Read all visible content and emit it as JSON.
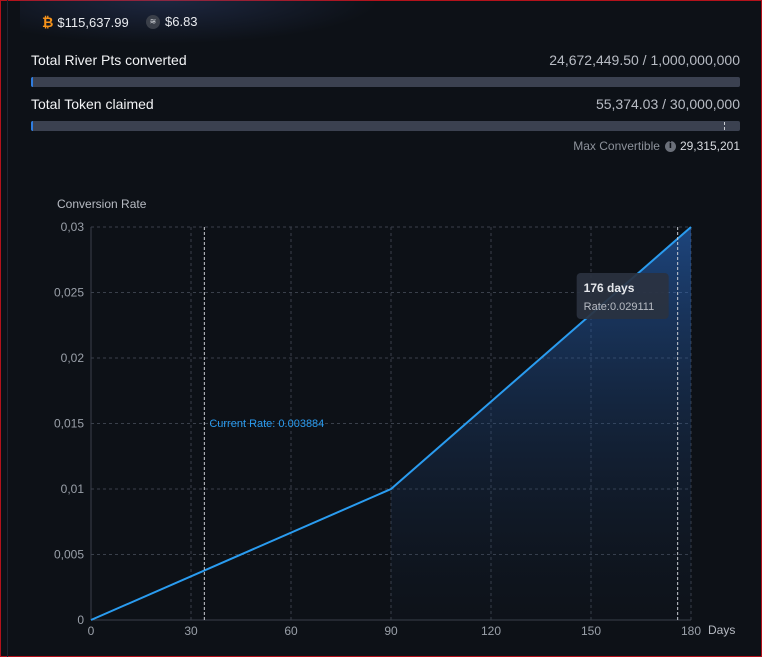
{
  "ticker": {
    "btc": {
      "icon": "bitcoin-icon",
      "price": "$115,637.99"
    },
    "river": {
      "icon": "river-token-icon",
      "price": "$6.83"
    }
  },
  "stats": {
    "river_pts": {
      "label": "Total River Pts converted",
      "value": "24,672,449.50 / 1,000,000,000",
      "fraction": 0.0247
    },
    "token_claimed": {
      "label": "Total Token claimed",
      "value": "55,374.03 / 30,000,000",
      "fraction": 0.0018,
      "marker_fraction": 0.977
    },
    "max_convertible": {
      "label": "Max Convertible",
      "value": "29,315,201",
      "icon": "info-icon"
    }
  },
  "colors": {
    "line": "#2a9cf0",
    "bar_fill": "#2f7de0",
    "bar_track": "#3b4150"
  },
  "chart_data": {
    "type": "line",
    "ylabel": "Conversion Rate",
    "xlabel": "Days",
    "xlim": [
      0,
      180
    ],
    "ylim": [
      0,
      0.03
    ],
    "x_ticks": [
      "0",
      "30",
      "60",
      "90",
      "120",
      "150",
      "180"
    ],
    "y_ticks": [
      "0",
      "0,005",
      "0,01",
      "0,015",
      "0,02",
      "0,025",
      "0,03"
    ],
    "grid": true,
    "x": [
      0,
      90,
      180
    ],
    "y": [
      0,
      0.01,
      0.03
    ],
    "current": {
      "day": 34,
      "label": "Current Rate: 0.003884"
    },
    "tooltip": {
      "day": 176,
      "title": "176 days",
      "rate": "Rate:0.029111"
    }
  }
}
